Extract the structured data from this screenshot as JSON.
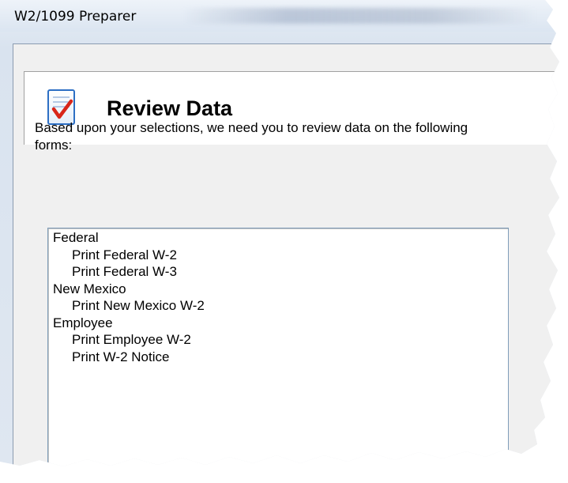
{
  "window": {
    "title": "W2/1099 Preparer"
  },
  "header": {
    "icon": "checklist-icon",
    "title": "Review Data"
  },
  "instructions": "Based upon your selections, we need you to review data on the following forms:",
  "forms_list": [
    {
      "label": "Federal",
      "type": "group"
    },
    {
      "label": "Print Federal W-2",
      "type": "item"
    },
    {
      "label": "Print Federal W-3",
      "type": "item"
    },
    {
      "label": "New Mexico",
      "type": "group"
    },
    {
      "label": "Print New Mexico W-2",
      "type": "item"
    },
    {
      "label": "Employee",
      "type": "group"
    },
    {
      "label": "Print Employee W-2",
      "type": "item"
    },
    {
      "label": "Print W-2 Notice",
      "type": "item"
    }
  ],
  "colors": {
    "check_mark": "#d8261a",
    "icon_border": "#2d6fc4"
  }
}
